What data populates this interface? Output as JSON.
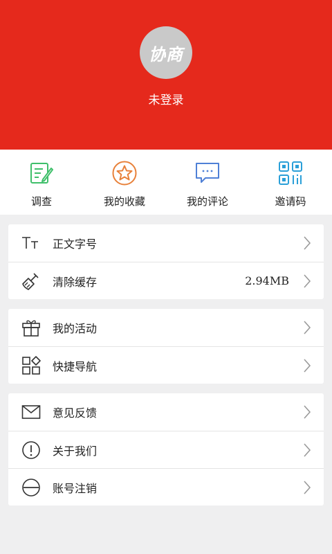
{
  "profile": {
    "avatar_text": "协商",
    "login_status": "未登录"
  },
  "quick": [
    {
      "label": "调查",
      "icon": "survey-edit-icon",
      "color": "#3fbf6a"
    },
    {
      "label": "我的收藏",
      "icon": "star-favorite-icon",
      "color": "#e8813a"
    },
    {
      "label": "我的评论",
      "icon": "comment-bubble-icon",
      "color": "#4f80d6"
    },
    {
      "label": "邀请码",
      "icon": "qr-code-icon",
      "color": "#2a9fd8"
    }
  ],
  "settings": {
    "font_size": "正文字号",
    "clear_cache": "清除缓存",
    "cache_size": "2.94MB",
    "my_activities": "我的活动",
    "quick_nav": "快捷导航",
    "feedback": "意见反馈",
    "about_us": "关于我们",
    "cancel_account": "账号注销"
  },
  "colors": {
    "header_bg": "#e5291c",
    "page_bg": "#efeff0"
  }
}
